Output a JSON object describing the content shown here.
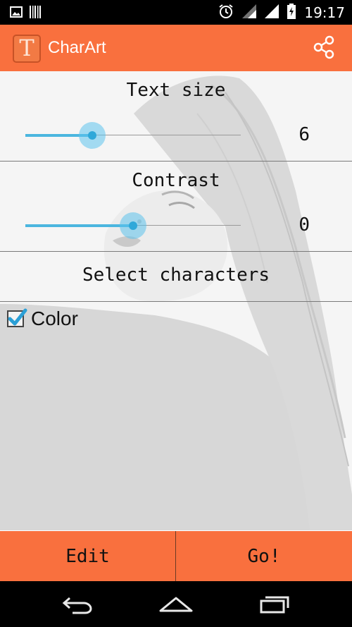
{
  "status_bar": {
    "time": "19:17",
    "icons": [
      "image-icon",
      "barcode-icon",
      "alarm-icon",
      "wifi-icon",
      "signal-icon",
      "battery-charging-icon"
    ]
  },
  "app_bar": {
    "icon_letter": "T",
    "title": "CharArt",
    "share_icon": "share-icon"
  },
  "text_size": {
    "label": "Text size",
    "value": "6",
    "slider_fraction": 0.31
  },
  "contrast": {
    "label": "Contrast",
    "value": "0",
    "slider_fraction": 0.5
  },
  "select_characters": {
    "label": "Select characters"
  },
  "color_option": {
    "label": "Color",
    "checked": true
  },
  "actions": {
    "edit_label": "Edit",
    "go_label": "Go!"
  },
  "nav_bar": {
    "icons": [
      "back-icon",
      "home-icon",
      "recent-apps-icon"
    ]
  },
  "colors": {
    "accent": "#f9703e",
    "slider": "#4bb6df"
  }
}
